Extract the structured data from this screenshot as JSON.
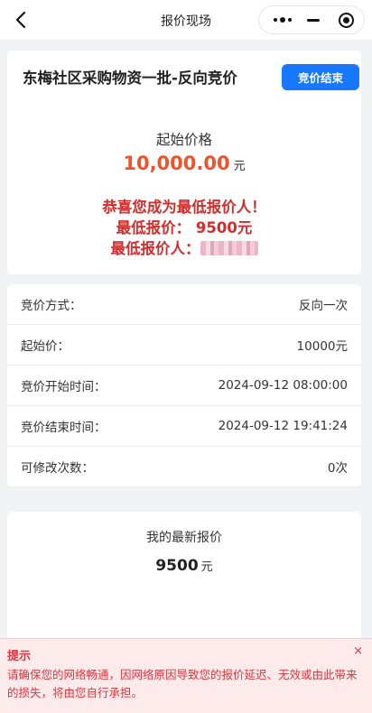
{
  "nav": {
    "title": "报价现场",
    "back_icon": "chevron-left-icon"
  },
  "auction": {
    "title": "东梅社区采购物资一批-反向竞价",
    "status_label": "竞价结束",
    "start_price_label": "起始价格",
    "start_price_value": "10,000.00",
    "currency_unit": "元",
    "congrats_text": "恭喜您成为最低报价人！",
    "lowest_bid_label": "最低报价：",
    "lowest_bid_value": "9500元",
    "lowest_bidder_label": "最低报价人："
  },
  "details": {
    "rows": [
      {
        "label": "竞价方式：",
        "value": "反向一次"
      },
      {
        "label": "起始价：",
        "value": "10000元"
      },
      {
        "label": "竞价开始时间：",
        "value": "2024-09-12 08:00:00"
      },
      {
        "label": "竞价结束时间：",
        "value": "2024-09-12 19:41:24"
      },
      {
        "label": "可修改次数：",
        "value": "0次"
      }
    ]
  },
  "my_bid": {
    "label": "我的最新报价",
    "value": "9500",
    "unit": "元"
  },
  "notice": {
    "title": "提示",
    "text": "请确保您的网络畅通，因网络原因导致您的报价延迟、无效或由此带来的损失，将由您自行承担。",
    "close_symbol": "×"
  },
  "colors": {
    "accent": "#1677ff",
    "price": "#f0532c",
    "congrats": "#d22c2c",
    "notice": "#d9363e"
  }
}
